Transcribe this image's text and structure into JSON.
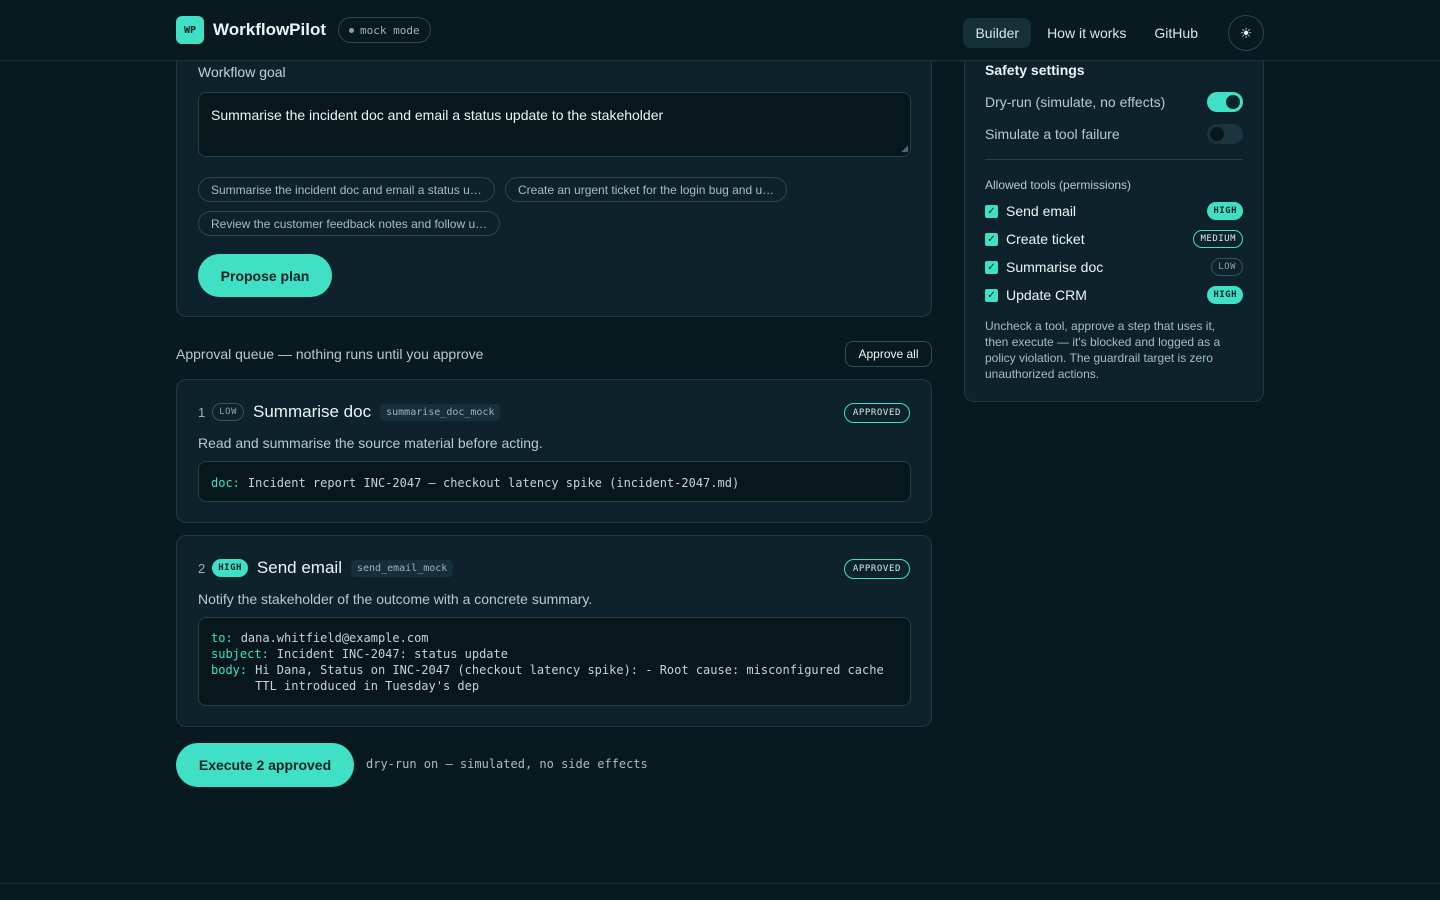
{
  "header": {
    "logo_text": "WP",
    "app_name": "WorkflowPilot",
    "mode_label": "mock mode",
    "nav": [
      {
        "label": "Builder",
        "active": true
      },
      {
        "label": "How it works",
        "active": false
      },
      {
        "label": "GitHub",
        "active": false
      }
    ],
    "theme_icon": "sun-icon"
  },
  "goal": {
    "label": "Workflow goal",
    "value": "Summarise the incident doc and email a status update to the stakeholder",
    "suggestions": [
      "Summarise the incident doc and email a status u…",
      "Create an urgent ticket for the login bug and u…",
      "Review the customer feedback notes and follow u…"
    ],
    "propose_label": "Propose plan"
  },
  "queue": {
    "title": "Approval queue — nothing runs until you approve",
    "approve_all_label": "Approve all",
    "steps": [
      {
        "number": "1",
        "risk": "LOW",
        "title": "Summarise doc",
        "tool": "summarise_doc_mock",
        "status": "APPROVED",
        "description": "Read and summarise the source material before acting.",
        "args": [
          {
            "key": "doc:",
            "value": "Incident report INC-2047 — checkout latency spike (incident-2047.md)"
          }
        ]
      },
      {
        "number": "2",
        "risk": "HIGH",
        "title": "Send email",
        "tool": "send_email_mock",
        "status": "APPROVED",
        "description": "Notify the stakeholder of the outcome with a concrete summary.",
        "args": [
          {
            "key": "to:",
            "value": "dana.whitfield@example.com"
          },
          {
            "key": "subject:",
            "value": "Incident INC-2047: status update"
          },
          {
            "key": "body:",
            "value": "Hi Dana, Status on INC-2047 (checkout latency spike): - Root cause: misconfigured cache TTL introduced in Tuesday's dep"
          }
        ]
      }
    ],
    "execute_label": "Execute 2 approved",
    "execute_note": "dry-run on — simulated, no side effects"
  },
  "safety": {
    "title": "Safety settings",
    "toggles": [
      {
        "label": "Dry-run (simulate, no effects)",
        "on": true
      },
      {
        "label": "Simulate a tool failure",
        "on": false
      }
    ],
    "permissions_title": "Allowed tools (permissions)",
    "permissions": [
      {
        "label": "Send email",
        "risk": "HIGH",
        "checked": true
      },
      {
        "label": "Create ticket",
        "risk": "MEDIUM",
        "checked": true
      },
      {
        "label": "Summarise doc",
        "risk": "LOW",
        "checked": true
      },
      {
        "label": "Update CRM",
        "risk": "HIGH",
        "checked": true
      }
    ],
    "note": "Uncheck a tool, approve a step that uses it, then execute — it's blocked and logged as a policy violation. The guardrail target is zero unauthorized actions."
  },
  "colors": {
    "background": "#081a20",
    "accent": "#3fe0c5",
    "card": "#0d222a"
  }
}
